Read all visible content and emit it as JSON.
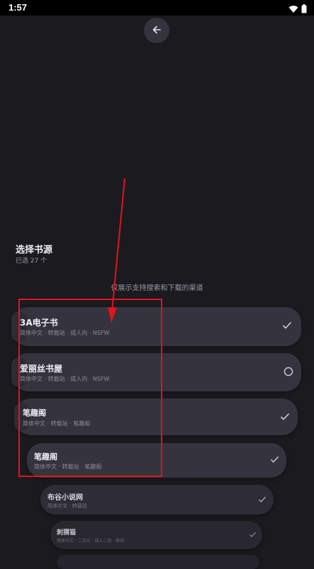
{
  "status_bar": {
    "time": "1:57",
    "icons": [
      "wifi-icon",
      "battery-icon"
    ]
  },
  "header": {
    "back_icon": "arrow-left-icon"
  },
  "page": {
    "title": "选择书源",
    "selected_count": "已选 27 个",
    "hint": "仅展示支持搜索和下载的渠道"
  },
  "sources": [
    {
      "name": "3A电子书",
      "tags": "简体中文 · 转载站 · 成人向 · NSFW",
      "selected": true
    },
    {
      "name": "爱丽丝书屋",
      "tags": "简体中文 · 转载站 · 成人向 · NSFW",
      "selected": false
    },
    {
      "name": "笔趣阁",
      "tags": "简体中文 · 转载站 · 笔趣阁",
      "selected": true
    },
    {
      "name": "笔趣阁",
      "tags": "简体中文 · 转载站 · 笔趣阁",
      "selected": true
    },
    {
      "name": "布谷小说网",
      "tags": "简体中文 · 转载站",
      "selected": true
    },
    {
      "name": "刺猬猫",
      "tags": "简体中文 · 二次元 · 成人二创 · 原创",
      "selected": true
    }
  ],
  "colors": {
    "background": "#1b1a1f",
    "card": "#35333d",
    "annotation": "#e0141d"
  }
}
